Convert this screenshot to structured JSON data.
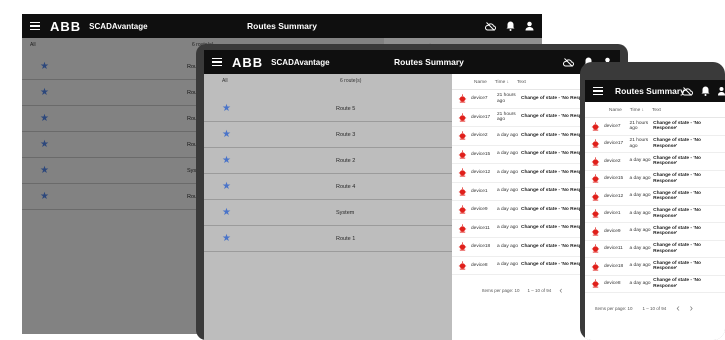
{
  "app": {
    "brand": "ABB",
    "name": "SCADAvantage",
    "title": "Routes Summary"
  },
  "list": {
    "filter_all": "All",
    "filter_count": "6 route(s)",
    "routes": [
      "Route 5",
      "Route 3",
      "Route 2",
      "Route 4",
      "System",
      "Route 1"
    ]
  },
  "events": {
    "col_name": "Name",
    "col_time": "Time ↓",
    "col_text": "Text",
    "rows": [
      {
        "device": "device7",
        "time": "21 hours ago",
        "text": "Change of state - 'No Response'"
      },
      {
        "device": "device17",
        "time": "21 hours ago",
        "text": "Change of state - 'No Response'"
      },
      {
        "device": "device2",
        "time": "a day ago",
        "text": "Change of state - 'No Response'"
      },
      {
        "device": "device15",
        "time": "a day ago",
        "text": "Change of state - 'No Response'"
      },
      {
        "device": "device12",
        "time": "a day ago",
        "text": "Change of state - 'No Response'"
      },
      {
        "device": "device1",
        "time": "a day ago",
        "text": "Change of state - 'No Response'"
      },
      {
        "device": "device9",
        "time": "a day ago",
        "text": "Change of state - 'No Response'"
      },
      {
        "device": "device11",
        "time": "a day ago",
        "text": "Change of state - 'No Response'"
      },
      {
        "device": "device18",
        "time": "a day ago",
        "text": "Change of state - 'No Response'"
      },
      {
        "device": "device8",
        "time": "a day ago",
        "text": "Change of state - 'No Response'"
      }
    ],
    "pager_label": "Items per page: 10",
    "pager_range": "1 – 10 of 94"
  },
  "colors": {
    "appbar": "#0f0f0f",
    "star": "#4a74c9",
    "alarm": "#e0201b"
  },
  "icons": [
    "menu-icon",
    "cloud-off-icon",
    "bell-icon",
    "user-icon",
    "star-icon",
    "alarm-icon",
    "chevron-left-icon",
    "chevron-right-icon"
  ]
}
